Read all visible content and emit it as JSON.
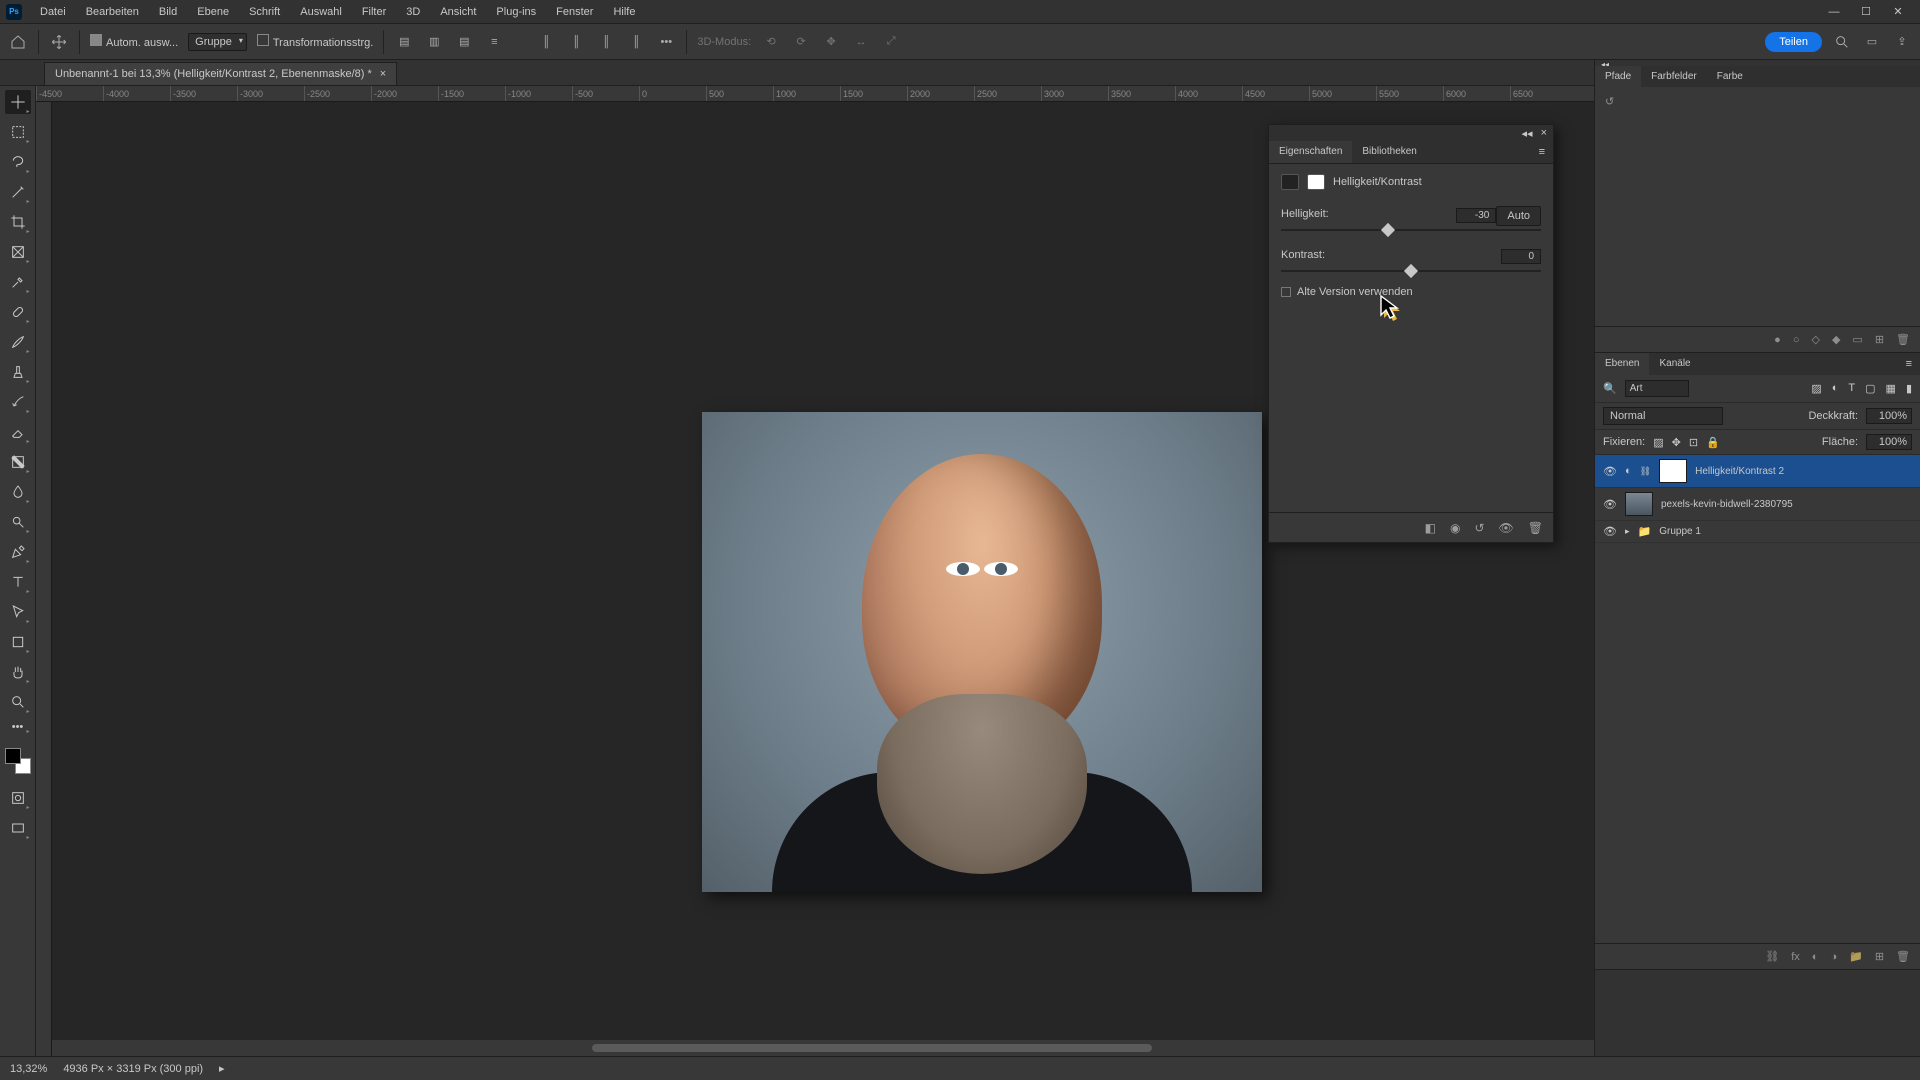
{
  "menu": [
    "Datei",
    "Bearbeiten",
    "Bild",
    "Ebene",
    "Schrift",
    "Auswahl",
    "Filter",
    "3D",
    "Ansicht",
    "Plug-ins",
    "Fenster",
    "Hilfe"
  ],
  "options": {
    "auto_select": "Autom. ausw...",
    "group_select": "Gruppe",
    "transform_ctrl": "Transformationsstrg.",
    "mode3d": "3D-Modus:",
    "share": "Teilen"
  },
  "doc_tab": {
    "title": "Unbenannt-1 bei 13,3% (Helligkeit/Kontrast 2, Ebenenmaske/8) *"
  },
  "ruler_ticks": [
    "-4500",
    "-4000",
    "-3500",
    "-3000",
    "-2500",
    "-2000",
    "-1500",
    "-1000",
    "-500",
    "0",
    "500",
    "1000",
    "1500",
    "2000",
    "2500",
    "3000",
    "3500",
    "4000",
    "4500",
    "5000",
    "5500",
    "6000",
    "6500"
  ],
  "props": {
    "tab_props": "Eigenschaften",
    "tab_libs": "Bibliotheken",
    "title": "Helligkeit/Kontrast",
    "auto": "Auto",
    "brightness_label": "Helligkeit:",
    "brightness_value": "-30",
    "contrast_label": "Kontrast:",
    "contrast_value": "0",
    "legacy": "Alte Version verwenden"
  },
  "dock_top": {
    "tabs": [
      "Pfade",
      "Farbfelder",
      "Farbe"
    ]
  },
  "layers_panel": {
    "tab_layers": "Ebenen",
    "tab_channels": "Kanäle",
    "filter_kind": "Art",
    "blend_mode": "Normal",
    "opacity_label": "Deckkraft:",
    "opacity_value": "100%",
    "lock_label": "Fixieren:",
    "fill_label": "Fläche:",
    "fill_value": "100%",
    "layers": [
      {
        "name": "Helligkeit/Kontrast 2",
        "kind": "adj",
        "selected": true
      },
      {
        "name": "pexels-kevin-bidwell-2380795",
        "kind": "img",
        "selected": false
      },
      {
        "name": "Gruppe 1",
        "kind": "grp",
        "selected": false
      }
    ]
  },
  "status": {
    "zoom": "13,32%",
    "info": "4936 Px × 3319 Px (300 ppi)"
  }
}
